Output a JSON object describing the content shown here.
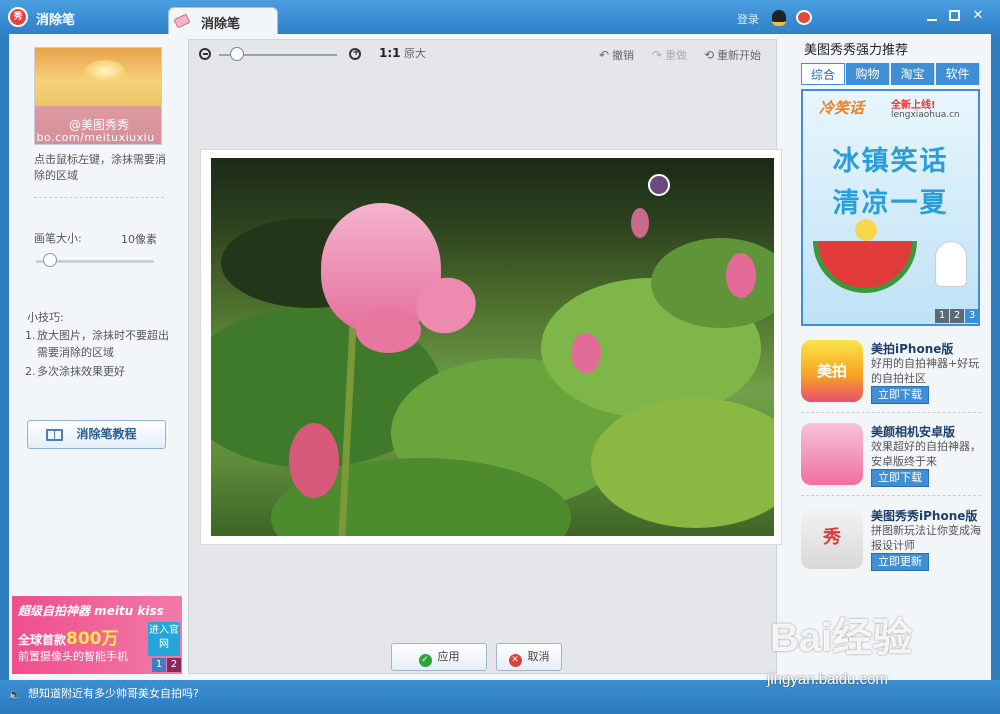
{
  "window": {
    "app_title": "消除笔",
    "tab_title": "消除笔",
    "login_label": "登录",
    "logo_glyph": "秀"
  },
  "left_panel": {
    "thumb_watermark": "@美图秀秀",
    "thumb_url": "ibo.com/meituxiuxiu",
    "hint": "点击鼠标左键，涂抹需要消除的区域",
    "brush_label": "画笔大小:",
    "brush_value": "10像素",
    "brush_level": 0.1,
    "tips_title": "小技巧:",
    "tips": [
      {
        "num": "1.",
        "text": "放大图片，涂抹时不要超出需要消除的区域"
      },
      {
        "num": "2.",
        "text": "多次涂抹效果更好"
      }
    ],
    "tutorial_label": "消除笔教程",
    "ad": {
      "line1": "超级自拍神器 meitu kiss",
      "line2_prefix": "全球首款",
      "line2_big": "800万",
      "line3": "前置摄像头的智能手机",
      "enter": "进入官网",
      "pages": [
        "1",
        "2"
      ]
    }
  },
  "editor": {
    "actual_size_icon": "1:1",
    "actual_size_label": "原大",
    "undo_label": "撤销",
    "redo_label": "重做",
    "restart_label": "重新开始",
    "zoom_level": 0.15,
    "apply_label": "应用",
    "cancel_label": "取消"
  },
  "right_panel": {
    "title": "美图秀秀强力推荐",
    "tabs": [
      "综合",
      "购物",
      "淘宝",
      "软件"
    ],
    "active_tab": 0,
    "banner": {
      "logo": "冷笑话",
      "badge": "全新上线!",
      "url": "lengxiaohua.cn",
      "line1": "冰镇笑话",
      "line2": "清凉一夏",
      "pages": [
        "1",
        "2",
        "3"
      ]
    },
    "apps": [
      {
        "name": "美拍iPhone版",
        "desc": "好用的自拍神器+好玩的自拍社区",
        "button": "立即下载",
        "icon_text": "美拍"
      },
      {
        "name": "美颜相机安卓版",
        "desc": "效果超好的自拍神器，安卓版终于来",
        "button": "立即下载",
        "icon_text": ""
      },
      {
        "name": "美图秀秀iPhone版",
        "desc": "拼图新玩法让你变成海报设计师",
        "button": "立即更新",
        "icon_text": "秀"
      }
    ]
  },
  "statusbar": {
    "text": "想知道附近有多少帅哥美女自拍吗?"
  },
  "watermark": {
    "brand": "Bai经验",
    "url": "jingyan.baidu.com"
  }
}
